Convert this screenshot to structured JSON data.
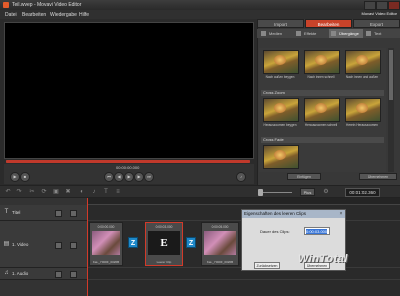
{
  "window": {
    "title": "Teil.wvep - Movavi Video Editor"
  },
  "menu": [
    "Datei",
    "Bearbeiten",
    "Wiedergabe",
    "Hilfe"
  ],
  "app_name": "Movavi Video Editor",
  "preview": {
    "timecode": "00:00:00.000",
    "progress": 1.0
  },
  "panel": {
    "tabs": [
      "Import",
      "Bearbeiten",
      "Export"
    ],
    "active_tab": "Bearbeiten",
    "subtabs": [
      "Medien",
      "Effekte",
      "Übergänge",
      "Text"
    ],
    "active_subtab": "Übergänge",
    "groups": [
      {
        "name": "",
        "items": [
          "Nach außen beygen",
          "Nach innen schnell",
          "Nach innen und außen"
        ]
      },
      {
        "name": "Cross Zoom",
        "items": [
          "Herauszoomen beygen",
          "Herauszoomen schnell",
          "Herein Herauszoomen"
        ]
      },
      {
        "name": "Cross Fade",
        "items": [
          ""
        ]
      }
    ],
    "buttons": [
      "Einfügen",
      "Übernehmen"
    ]
  },
  "toolbar": {
    "plus_label": "Plus",
    "duration": "00:01:02.360"
  },
  "tracks": [
    {
      "icon": "T",
      "label": "Titel"
    },
    {
      "icon": "▤",
      "label": "1. Video"
    },
    {
      "icon": "♫",
      "label": "1. Audio"
    }
  ],
  "clips": [
    {
      "time": "0:00:00.000",
      "name": "Kai‑_Y000F_0026B"
    },
    {
      "time": "0:00:03.000",
      "name": "Leerer Clip"
    },
    {
      "time": "0:00:05.000",
      "name": "Kai‑_Y000F_0026B"
    }
  ],
  "dialog": {
    "title": "Eigenschaften des leeren Clips",
    "label": "Dauer des Clips:",
    "value": "0:00:03.000",
    "ok": "Übernehmen",
    "cancel": "Zurücksetzen"
  },
  "watermark": "WinTotal"
}
